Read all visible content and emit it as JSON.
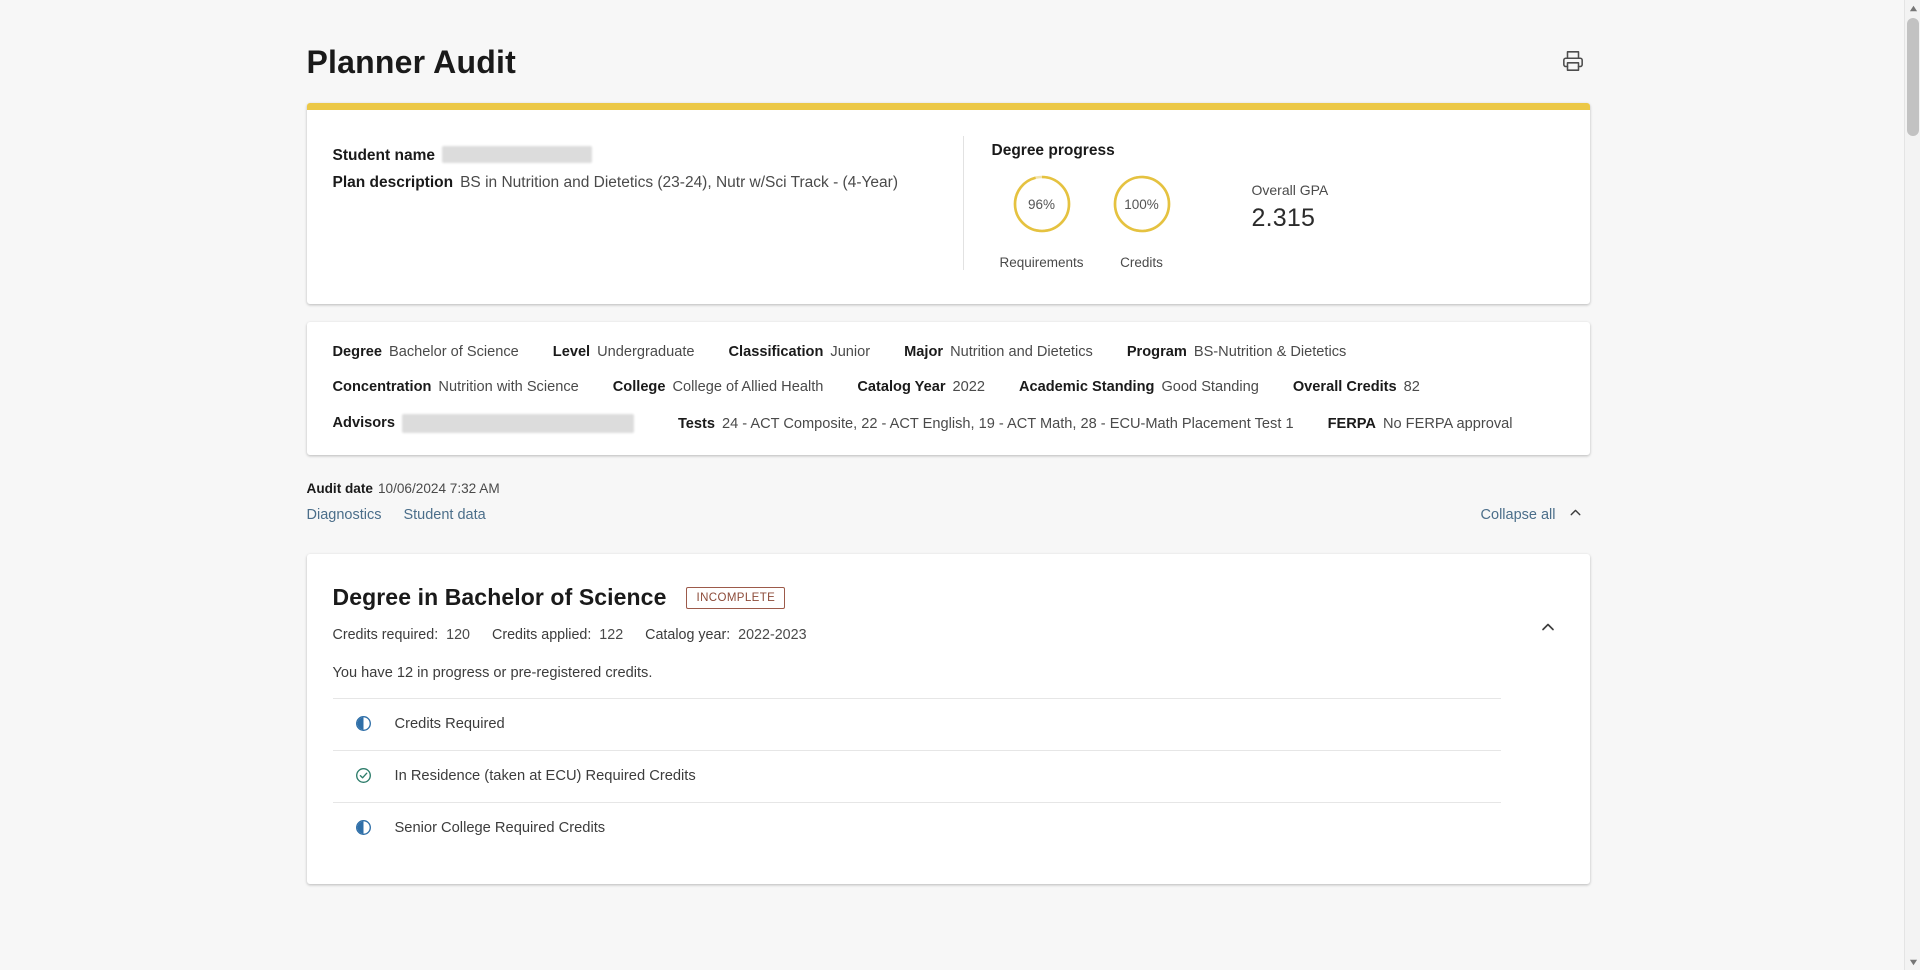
{
  "header": {
    "title": "Planner Audit",
    "print_icon": "printer-icon"
  },
  "summary": {
    "student_name_label": "Student name",
    "student_name_value": "",
    "plan_description_label": "Plan description",
    "plan_description_value": "BS in Nutrition and Dietetics (23-24), Nutr w/Sci Track - (4-Year)",
    "degree_progress_label": "Degree progress",
    "rings": [
      {
        "percent_text": "96%",
        "percent": 96,
        "caption": "Requirements"
      },
      {
        "percent_text": "100%",
        "percent": 100,
        "caption": "Credits"
      }
    ],
    "gpa_label": "Overall GPA",
    "gpa_value": "2.315",
    "accent_color": "#ecc846"
  },
  "attributes": {
    "row1": [
      {
        "label": "Degree",
        "value": "Bachelor of Science"
      },
      {
        "label": "Level",
        "value": "Undergraduate"
      },
      {
        "label": "Classification",
        "value": "Junior"
      },
      {
        "label": "Major",
        "value": "Nutrition and Dietetics"
      },
      {
        "label": "Program",
        "value": "BS-Nutrition & Dietetics"
      }
    ],
    "row2": [
      {
        "label": "Concentration",
        "value": "Nutrition with Science"
      },
      {
        "label": "College",
        "value": "College of Allied Health"
      },
      {
        "label": "Catalog Year",
        "value": "2022"
      },
      {
        "label": "Academic Standing",
        "value": "Good Standing"
      },
      {
        "label": "Overall Credits",
        "value": "82"
      }
    ],
    "row3": [
      {
        "label": "Advisors",
        "value": ""
      },
      {
        "label": "Tests",
        "value": "24 - ACT Composite, 22 - ACT English, 19 - ACT Math, 28 - ECU-Math Placement Test 1"
      },
      {
        "label": "FERPA",
        "value": "No FERPA approval"
      }
    ]
  },
  "meta": {
    "audit_date_label": "Audit date",
    "audit_date_value": "10/06/2024 7:32 AM",
    "links": [
      {
        "label": "Diagnostics"
      },
      {
        "label": "Student data"
      }
    ],
    "collapse_all_label": "Collapse all"
  },
  "requirement_block": {
    "title": "Degree in Bachelor of Science",
    "badge": "INCOMPLETE",
    "badge_color": "#8c4a38",
    "credits_required_label": "Credits required:",
    "credits_required_value": "120",
    "credits_applied_label": "Credits applied:",
    "credits_applied_value": "122",
    "catalog_year_label": "Catalog year:",
    "catalog_year_value": "2022-2023",
    "note": "You have 12 in progress or pre-registered credits.",
    "items": [
      {
        "status": "in-progress",
        "text": "Credits Required"
      },
      {
        "status": "complete",
        "text": "In Residence (taken at ECU) Required Credits"
      },
      {
        "status": "in-progress",
        "text": "Senior College Required Credits"
      }
    ],
    "status_colors": {
      "in_progress": "#2f6fa8",
      "complete": "#2e7d6b"
    }
  }
}
